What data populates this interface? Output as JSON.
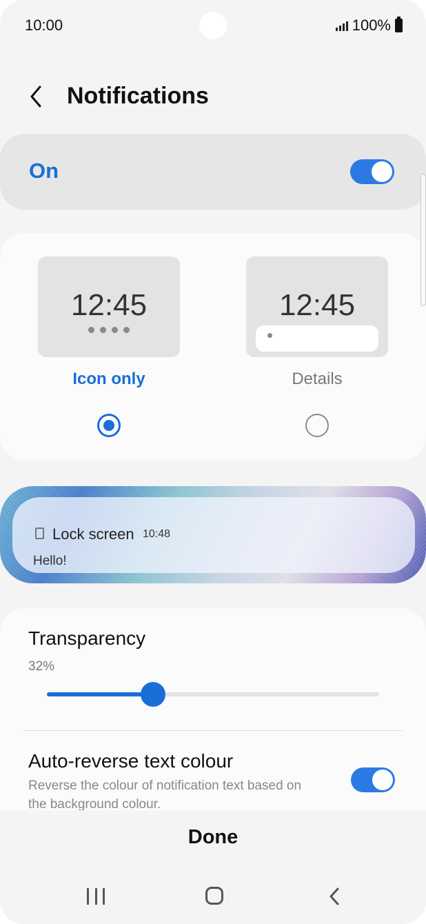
{
  "status_bar": {
    "time": "10:00",
    "battery": "100%"
  },
  "header": {
    "title": "Notifications"
  },
  "master_toggle": {
    "label": "On",
    "state": "on"
  },
  "style_options": [
    {
      "clock": "12:45",
      "label": "Icon only",
      "selected": true
    },
    {
      "clock": "12:45",
      "label": "Details",
      "selected": false
    }
  ],
  "preview": {
    "app": "Lock screen",
    "time": "10:48",
    "message": "Hello!"
  },
  "transparency": {
    "label": "Transparency",
    "value_text": "32%",
    "value": 32
  },
  "auto_reverse": {
    "label": "Auto-reverse text colour",
    "description": "Reverse the colour of notification text based on the background colour.",
    "state": "on"
  },
  "footer": {
    "done_label": "Done"
  },
  "colors": {
    "accent": "#1a6ed8",
    "toggle_on": "#2b7ae4",
    "background": "#f4f4f4"
  },
  "icons": [
    "signal-icon",
    "battery-icon",
    "back-arrow-icon",
    "lock-screen-app-icon",
    "recent-apps-icon",
    "home-icon",
    "nav-back-icon"
  ]
}
